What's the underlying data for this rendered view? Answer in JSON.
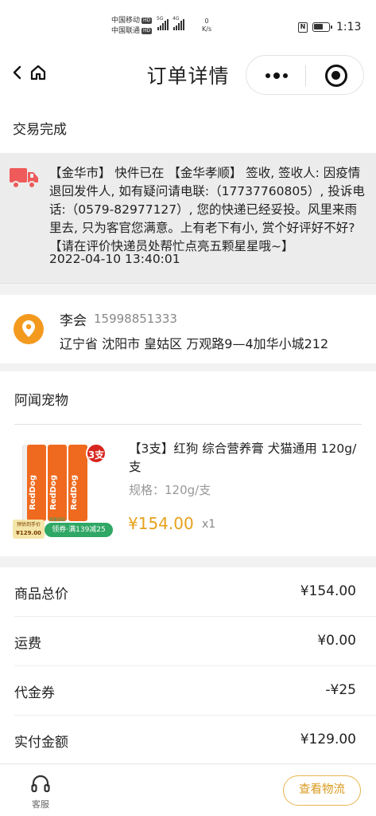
{
  "status_bar": {
    "carrier1": "中国移动",
    "carrier2": "中国联通",
    "hd": "HD",
    "net1": "5G",
    "net2": "4G",
    "speed_value": "0",
    "speed_unit": "K/s",
    "nfc": "N",
    "battery_level": 0.65,
    "time": "1:13"
  },
  "nav": {
    "title": "订单详情"
  },
  "order": {
    "status": "交易完成"
  },
  "logistics": {
    "message": "【金华市】 快件已在 【金华孝顺】 签收, 签收人: 因疫情退回发件人, 如有疑问请电联:（17737760805）, 投诉电话:（0579-82977127）, 您的快递已经妥投。风里来雨里去, 只为客官您满意。上有老下有小, 赏个好评好不好?【请在评价快递员处帮忙点亮五颗星星哦~】",
    "time": "2022-04-10 13:40:01"
  },
  "address": {
    "name": "李会",
    "phone": "15998851333",
    "detail": "辽宁省 沈阳市 皇姑区 万观路9—4加华小城212"
  },
  "shop": {
    "name": "阿闻宠物"
  },
  "product": {
    "title": "【3支】红狗 综合营养膏 犬猫通用 120g/支",
    "spec": "规格：120g/支",
    "price": "¥154.00",
    "qty": "x1",
    "image": {
      "brand": "RedDog",
      "badge": "3支",
      "tag_price": "¥129.00",
      "tag_note": "预估到手价",
      "coupon": "领券·满139减25",
      "coupon_top": "限量领取"
    },
    "colors": {
      "tube": "#ef6a1f",
      "badge": "#d7261f",
      "price": "#e6a11b"
    }
  },
  "summary": {
    "rows": [
      {
        "label": "商品总价",
        "value": "¥154.00"
      },
      {
        "label": "运费",
        "value": "¥0.00"
      },
      {
        "label": "代金券",
        "value": "-¥25"
      },
      {
        "label": "实付金额",
        "value": "¥129.00"
      }
    ]
  },
  "bottom": {
    "service_label": "客服",
    "track_button": "查看物流"
  }
}
